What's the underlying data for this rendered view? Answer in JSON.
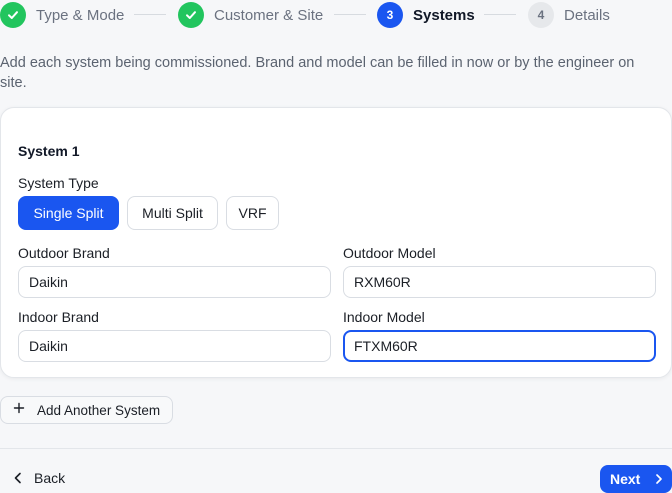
{
  "stepper": {
    "steps": [
      {
        "number": "1",
        "label": "Type & Mode",
        "state": "done"
      },
      {
        "number": "2",
        "label": "Customer & Site",
        "state": "done"
      },
      {
        "number": "3",
        "label": "Systems",
        "state": "active"
      },
      {
        "number": "4",
        "label": "Details",
        "state": "todo"
      }
    ],
    "done_icon": "check-icon",
    "colors": {
      "done": "#22c55e",
      "active": "#1a56f0",
      "todo": "#e6e8eb"
    }
  },
  "intro_text": "Add each system being commissioned. Brand and model can be filled in now or by the engineer on site.",
  "system": {
    "title": "System 1",
    "type_label": "System Type",
    "types": [
      {
        "label": "Single Split",
        "selected": true
      },
      {
        "label": "Multi Split",
        "selected": false
      },
      {
        "label": "VRF",
        "selected": false
      }
    ],
    "outdoor_brand": {
      "label": "Outdoor Brand",
      "value": "Daikin"
    },
    "outdoor_model": {
      "label": "Outdoor Model",
      "value": "RXM60R"
    },
    "indoor_brand": {
      "label": "Indoor Brand",
      "value": "Daikin"
    },
    "indoor_model": {
      "label": "Indoor Model",
      "value": "FTXM60R"
    }
  },
  "add_system": {
    "label": "Add Another System",
    "icon": "plus-icon"
  },
  "footer": {
    "back_label": "Back",
    "back_icon": "chevron-left-icon",
    "next_label": "Next",
    "next_icon": "chevron-right-icon"
  },
  "accent_color": "#1a56f0"
}
